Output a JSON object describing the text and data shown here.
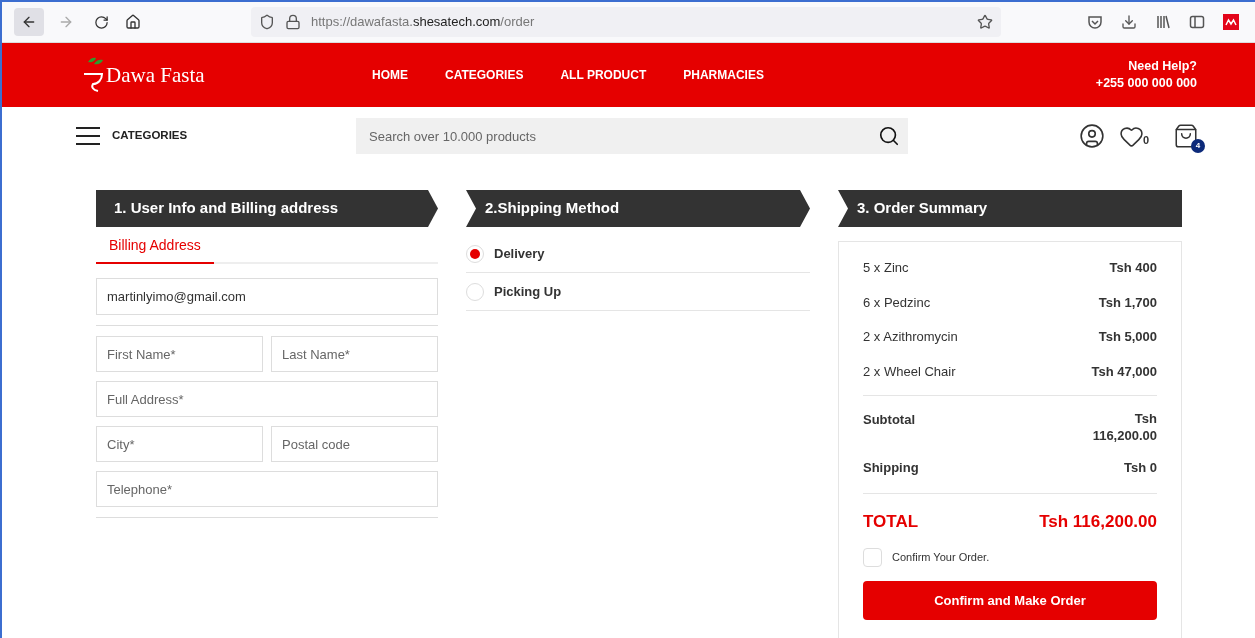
{
  "browser": {
    "url_prefix": "https://dawafasta.",
    "url_domain": "shesatech.com",
    "url_path": "/order"
  },
  "header": {
    "logo": "Dawa Fasta",
    "nav": [
      "HOME",
      "CATEGORIES",
      "ALL PRODUCT",
      "PHARMACIES"
    ],
    "help_title": "Need Help?",
    "help_phone": "+255 000 000 000"
  },
  "subbar": {
    "categories": "CATEGORIES",
    "search_placeholder": "Search over 10.000 products",
    "wishlist_count": "0",
    "cart_count": "4"
  },
  "steps": [
    "1. User Info and Billing address",
    "2.Shipping Method",
    "3. Order Summary"
  ],
  "billing": {
    "tabs": [
      {
        "label": "Billing Address",
        "selected": true
      }
    ],
    "email": "martinlyimo@gmail.com",
    "rows": [
      [
        {
          "placeholder": "First Name*"
        },
        {
          "placeholder": "Last Name*"
        }
      ],
      [
        {
          "placeholder": "Full Address*"
        }
      ],
      [
        {
          "placeholder": "City*"
        },
        {
          "placeholder": "Postal code"
        }
      ],
      [
        {
          "placeholder": "Telephone*"
        }
      ]
    ]
  },
  "shipping": [
    {
      "label": "Delivery",
      "selected": true
    },
    {
      "label": "Picking Up",
      "selected": false
    }
  ],
  "summary": {
    "items": [
      {
        "name": "5 x Zinc",
        "price": "Tsh 400"
      },
      {
        "name": "6 x Pedzinc",
        "price": "Tsh 1,700"
      },
      {
        "name": "2 x Azithromycin",
        "price": "Tsh 5,000"
      },
      {
        "name": "2 x Wheel Chair",
        "price": "Tsh 47,000"
      }
    ],
    "subtotal_label": "Subtotal",
    "subtotal_value": "Tsh 116,200.00",
    "shipping_label": "Shipping",
    "shipping_value": "Tsh 0",
    "total_label": "TOTAL",
    "total_value": "Tsh 116,200.00",
    "confirm_label": "Confirm Your Order.",
    "confirm_checked": false,
    "button": "Confirm and Make Order"
  }
}
